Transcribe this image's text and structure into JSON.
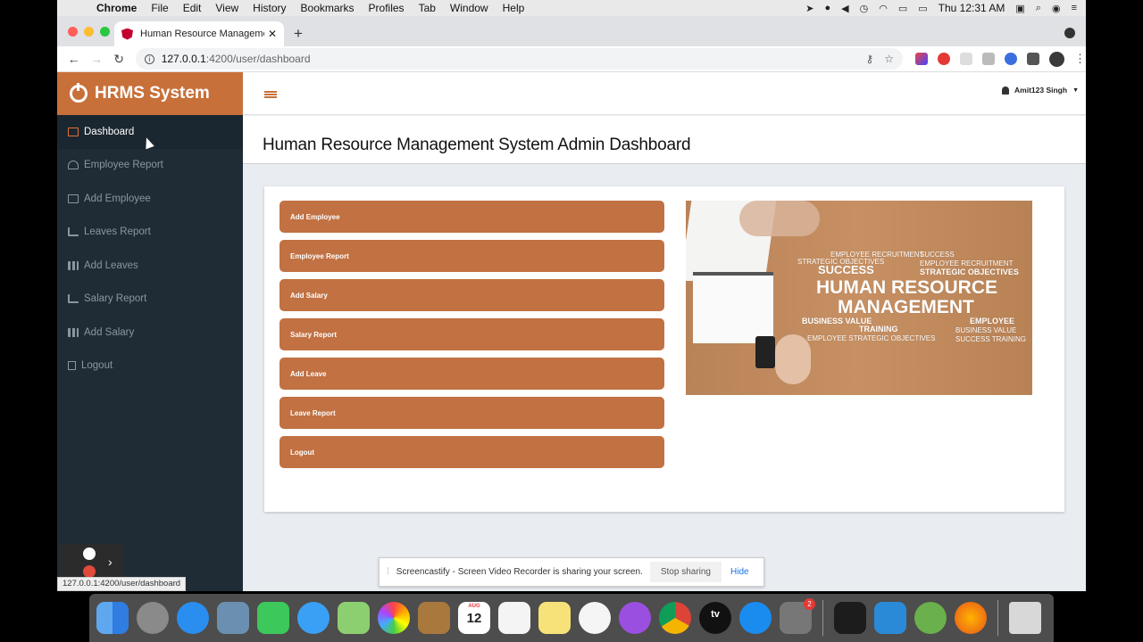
{
  "menubar": {
    "apple": "",
    "items": [
      "Chrome",
      "File",
      "Edit",
      "View",
      "History",
      "Bookmarks",
      "Profiles",
      "Tab",
      "Window",
      "Help"
    ],
    "clock": "Thu 12:31 AM"
  },
  "browser": {
    "tab_title": "Human Resource Managemen",
    "new_tab": "+",
    "close_tab": "✕",
    "url": "127.0.0.1:4200/user/dashboard",
    "url_host": "127.0.0.1",
    "url_rest": ":4200/user/dashboard",
    "status_url": "127.0.0.1:4200/user/dashboard"
  },
  "app": {
    "brand": "HRMS System",
    "user_name": "Amit123 Singh",
    "page_title": "Human Resource Management System Admin Dashboard",
    "sidebar": [
      {
        "label": "Dashboard",
        "icon": "monitor-icon",
        "active": true
      },
      {
        "label": "Employee Report",
        "icon": "dashboard-icon"
      },
      {
        "label": "Add Employee",
        "icon": "monitor-icon"
      },
      {
        "label": "Leaves Report",
        "icon": "bar-chart-icon"
      },
      {
        "label": "Add Leaves",
        "icon": "grid-icon"
      },
      {
        "label": "Salary Report",
        "icon": "bar-chart-icon"
      },
      {
        "label": "Add Salary",
        "icon": "grid-icon"
      },
      {
        "label": "Logout",
        "icon": "file-icon"
      }
    ],
    "actions": [
      "Add Employee",
      "Employee Report",
      "Add Salary",
      "Salary Report",
      "Add Leave",
      "Leave Report",
      "Logout"
    ],
    "banner": {
      "headline1": "HUMAN RESOURCE",
      "headline2": "MANAGEMENT",
      "words": [
        "SUCCESS",
        "STRATEGIC OBJECTIVES",
        "BUSINESS VALUE",
        "TRAINING",
        "EMPLOYEE",
        "EMPLOYEE RECRUITMENT",
        "SUCCESS TRAINING",
        "EMPLOYEE STRATEGIC OBJECTIVES",
        "BUSINESS VALUE"
      ]
    }
  },
  "share_bar": {
    "message": "Screencastify - Screen Video Recorder is sharing your screen.",
    "stop": "Stop sharing",
    "hide": "Hide"
  },
  "dock": {
    "calendar_month": "AUG",
    "calendar_day": "12",
    "settings_badge": "2",
    "tv_label": "tv"
  },
  "colors": {
    "brand": "#c8703a",
    "sidebar": "#1f2c36",
    "button": "#c17142"
  }
}
